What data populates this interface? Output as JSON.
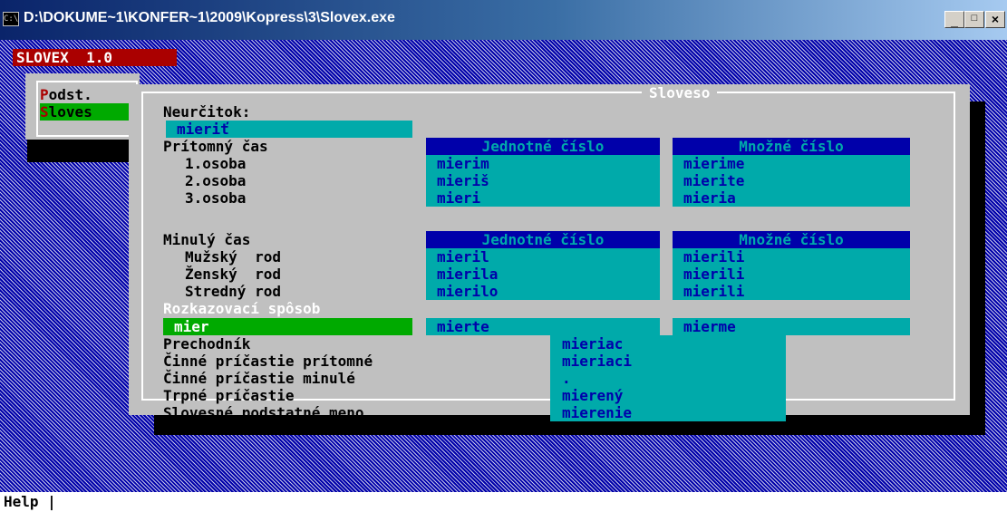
{
  "window": {
    "title": "D:\\DOKUME~1\\KONFER~1\\2009\\Kopress\\3\\Slovex.exe",
    "icon": "C:\\"
  },
  "app_title": "SLOVEX  1.0",
  "menu": {
    "items": [
      {
        "hot": "P",
        "rest": "odst."
      },
      {
        "hot": "S",
        "rest": "loves"
      }
    ]
  },
  "dialog": {
    "title": "Sloveso",
    "neurcitok_label": "Neurčitok:",
    "neurcitok_value": "mieriť",
    "present": {
      "label": "Prítomný čas",
      "singular_header": "Jednotné číslo",
      "plural_header": "Množné číslo",
      "rows": [
        {
          "label": "1.osoba",
          "singular": "mierim",
          "plural": "mierime"
        },
        {
          "label": "2.osoba",
          "singular": "mieriš",
          "plural": "mierite"
        },
        {
          "label": "3.osoba",
          "singular": "mieri",
          "plural": "mieria"
        }
      ]
    },
    "past": {
      "label": "Minulý čas",
      "singular_header": "Jednotné číslo",
      "plural_header": "Množné číslo",
      "rows": [
        {
          "label": "Mužský  rod",
          "singular": "mieril",
          "plural": "mierili"
        },
        {
          "label": "Ženský  rod",
          "singular": "mierila",
          "plural": "mierili"
        },
        {
          "label": "Stredný rod",
          "singular": "mierilo",
          "plural": "mierili"
        }
      ]
    },
    "imperative": {
      "label": "Rozkazovací spôsob",
      "value": "mier",
      "singular": "mierte",
      "plural": "mierme"
    },
    "other_forms": [
      {
        "label": "Prechodník",
        "value": "mieriac"
      },
      {
        "label": "Činné príčastie prítomné",
        "value": "mieriaci"
      },
      {
        "label": "Činné príčastie minulé",
        "value": "."
      },
      {
        "label": "Trpné príčastie",
        "value": "mierený"
      },
      {
        "label": "Slovesné podstatné meno",
        "value": "mierenie"
      }
    ]
  },
  "status": {
    "help": "Help |"
  }
}
